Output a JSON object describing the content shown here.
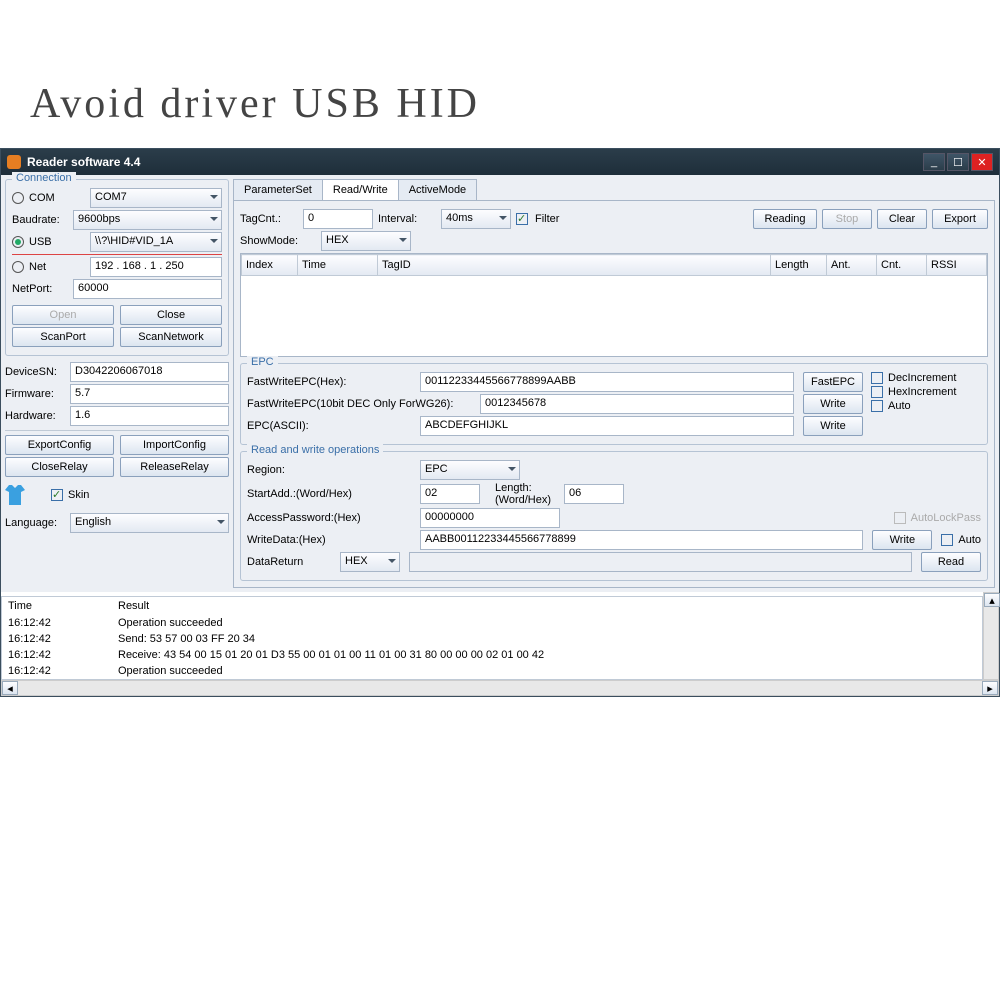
{
  "page_heading": "Avoid driver USB HID",
  "window_title": "Reader software 4.4",
  "connection": {
    "title": "Connection",
    "com_label": "COM",
    "com_value": "COM7",
    "baud_label": "Baudrate:",
    "baud_value": "9600bps",
    "usb_label": "USB",
    "usb_value": "\\\\?\\HID#VID_1A",
    "net_label": "Net",
    "net_value": "192 . 168 .  1  . 250",
    "netport_label": "NetPort:",
    "netport_value": "60000",
    "open_btn": "Open",
    "close_btn": "Close",
    "scanport_btn": "ScanPort",
    "scannet_btn": "ScanNetwork"
  },
  "device": {
    "sn_label": "DeviceSN:",
    "sn_value": "D3042206067018",
    "fw_label": "Firmware:",
    "fw_value": "5.7",
    "hw_label": "Hardware:",
    "hw_value": "1.6",
    "exportcfg_btn": "ExportConfig",
    "importcfg_btn": "ImportConfig",
    "closerelay_btn": "CloseRelay",
    "releaserelay_btn": "ReleaseRelay",
    "skin_label": "Skin",
    "lang_label": "Language:",
    "lang_value": "English"
  },
  "tabs": {
    "param": "ParameterSet",
    "rw": "Read/Write",
    "active": "ActiveMode"
  },
  "rw": {
    "tagcnt_label": "TagCnt.:",
    "tagcnt_value": "0",
    "interval_label": "Interval:",
    "interval_value": "40ms",
    "filter_label": "Filter",
    "reading_btn": "Reading",
    "stop_btn": "Stop",
    "clear_btn": "Clear",
    "export_btn": "Export",
    "showmode_label": "ShowMode:",
    "showmode_value": "HEX",
    "cols": [
      "Index",
      "Time",
      "TagID",
      "Length",
      "Ant.",
      "Cnt.",
      "RSSI"
    ]
  },
  "epc": {
    "title": "EPC",
    "fastwrite_label": "FastWriteEPC(Hex):",
    "fastwrite_value": "00112233445566778899AABB",
    "fastepc_btn": "FastEPC",
    "fastwrite10_label": "FastWriteEPC(10bit DEC Only ForWG26):",
    "fastwrite10_value": "0012345678",
    "write_btn": "Write",
    "ascii_label": "EPC(ASCII):",
    "ascii_value": "ABCDEFGHIJKL",
    "decinc_label": "DecIncrement",
    "hexinc_label": "HexIncrement",
    "auto_label": "Auto"
  },
  "ops": {
    "title": "Read and write operations",
    "region_label": "Region:",
    "region_value": "EPC",
    "startadd_label": "StartAdd.:(Word/Hex)",
    "startadd_value": "02",
    "length_label": "Length:(Word/Hex)",
    "length_value": "06",
    "accpwd_label": "AccessPassword:(Hex)",
    "accpwd_value": "00000000",
    "autolock_label": "AutoLockPass",
    "writedata_label": "WriteData:(Hex)",
    "writedata_value": "AABB00112233445566778899",
    "write_btn": "Write",
    "auto_label": "Auto",
    "dataret_label": "DataReturn",
    "dataret_value": "HEX",
    "read_btn": "Read"
  },
  "log": {
    "cols": [
      "Time",
      "Result"
    ],
    "rows": [
      {
        "time": "16:12:42",
        "result": "Operation succeeded"
      },
      {
        "time": "16:12:42",
        "result": "Send: 53 57 00 03 FF 20 34"
      },
      {
        "time": "16:12:42",
        "result": "Receive: 43 54 00 15 01 20 01 D3 55 00 01 01 00 11 01 00 31 80 00 00 00 02 01 00 42"
      },
      {
        "time": "16:12:42",
        "result": "Operation succeeded"
      }
    ]
  }
}
